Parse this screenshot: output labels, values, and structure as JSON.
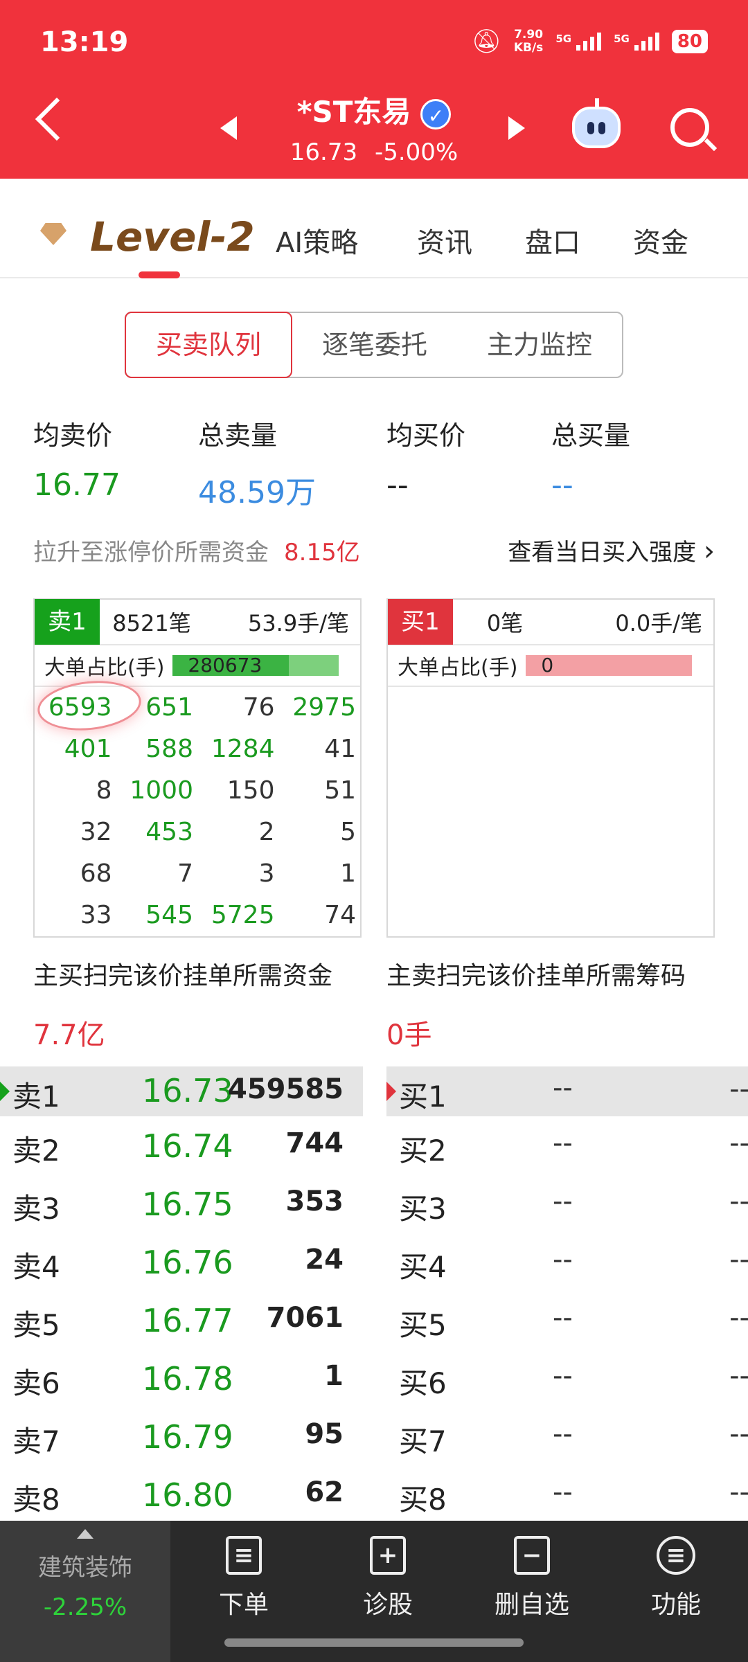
{
  "status_bar": {
    "time": "13:19",
    "net_speed": "7.90",
    "net_unit": "KB/s",
    "sig1": "5G",
    "sig2": "5G",
    "battery": "80"
  },
  "header": {
    "stock_name": "*ST东易",
    "verified_mark": "✓",
    "price": "16.73",
    "change_pct": "-5.00%",
    "brand_color": "#f0323c"
  },
  "tabs": [
    "Level-2",
    "AI策略",
    "资讯",
    "盘口",
    "资金"
  ],
  "segments": [
    "买卖队列",
    "逐笔委托",
    "主力监控"
  ],
  "stats": {
    "avg_sell_label": "均卖价",
    "avg_sell": "16.77",
    "total_sell_label": "总卖量",
    "total_sell": "48.59万",
    "avg_buy_label": "均买价",
    "avg_buy": "--",
    "total_buy_label": "总买量",
    "total_buy": "--"
  },
  "limit_fund": {
    "label": "拉升至涨停价所需资金",
    "value": "8.15亿",
    "link": "查看当日买入强度",
    "link_arrow": "›"
  },
  "sell_queue": {
    "tag": "卖1",
    "count": "8521笔",
    "avg": "53.9手/笔",
    "big_label": "大单占比(手)",
    "big_value": "280673",
    "big_ratio": 0.7,
    "cells": [
      {
        "v": "6593",
        "c": "green"
      },
      {
        "v": "651",
        "c": "green"
      },
      {
        "v": "76",
        "c": "dark"
      },
      {
        "v": "2975",
        "c": "green"
      },
      {
        "v": "401",
        "c": "green"
      },
      {
        "v": "588",
        "c": "green"
      },
      {
        "v": "1284",
        "c": "green"
      },
      {
        "v": "41",
        "c": "dark"
      },
      {
        "v": "8",
        "c": "dark"
      },
      {
        "v": "1000",
        "c": "green"
      },
      {
        "v": "150",
        "c": "dark"
      },
      {
        "v": "51",
        "c": "dark"
      },
      {
        "v": "32",
        "c": "dark"
      },
      {
        "v": "453",
        "c": "green"
      },
      {
        "v": "2",
        "c": "dark"
      },
      {
        "v": "5",
        "c": "dark"
      },
      {
        "v": "68",
        "c": "dark"
      },
      {
        "v": "7",
        "c": "dark"
      },
      {
        "v": "3",
        "c": "dark"
      },
      {
        "v": "1",
        "c": "dark"
      },
      {
        "v": "33",
        "c": "dark"
      },
      {
        "v": "545",
        "c": "green"
      },
      {
        "v": "5725",
        "c": "green"
      },
      {
        "v": "74",
        "c": "dark"
      }
    ]
  },
  "buy_queue": {
    "tag": "买1",
    "count": "0笔",
    "avg": "0.0手/笔",
    "big_label": "大单占比(手)",
    "big_value": "0"
  },
  "sweep": {
    "buy_label": "主买扫完该价挂单所需资金",
    "buy_value": "7.7亿",
    "sell_label": "主卖扫完该价挂单所需筹码",
    "sell_value": "0手"
  },
  "asks": [
    {
      "level": "卖1",
      "price": "16.73",
      "volume": "459585"
    },
    {
      "level": "卖2",
      "price": "16.74",
      "volume": "744"
    },
    {
      "level": "卖3",
      "price": "16.75",
      "volume": "353"
    },
    {
      "level": "卖4",
      "price": "16.76",
      "volume": "24"
    },
    {
      "level": "卖5",
      "price": "16.77",
      "volume": "7061"
    },
    {
      "level": "卖6",
      "price": "16.78",
      "volume": "1"
    },
    {
      "level": "卖7",
      "price": "16.79",
      "volume": "95"
    },
    {
      "level": "卖8",
      "price": "16.80",
      "volume": "62"
    }
  ],
  "bids": [
    {
      "level": "买1",
      "price": "--",
      "volume": "--"
    },
    {
      "level": "买2",
      "price": "--",
      "volume": "--"
    },
    {
      "level": "买3",
      "price": "--",
      "volume": "--"
    },
    {
      "level": "买4",
      "price": "--",
      "volume": "--"
    },
    {
      "level": "买5",
      "price": "--",
      "volume": "--"
    },
    {
      "level": "买6",
      "price": "--",
      "volume": "--"
    },
    {
      "level": "买7",
      "price": "--",
      "volume": "--"
    },
    {
      "level": "买8",
      "price": "--",
      "volume": "--"
    }
  ],
  "bottom_nav": {
    "sector_name": "建筑装饰",
    "sector_change": "-2.25%",
    "items": [
      {
        "label": "下单",
        "icon": "order-icon",
        "glyph": "≡"
      },
      {
        "label": "诊股",
        "icon": "diagnose-icon",
        "glyph": "+"
      },
      {
        "label": "删自选",
        "icon": "remove-watchlist-icon",
        "glyph": "−"
      },
      {
        "label": "功能",
        "icon": "functions-icon",
        "glyph": "≡"
      }
    ]
  }
}
